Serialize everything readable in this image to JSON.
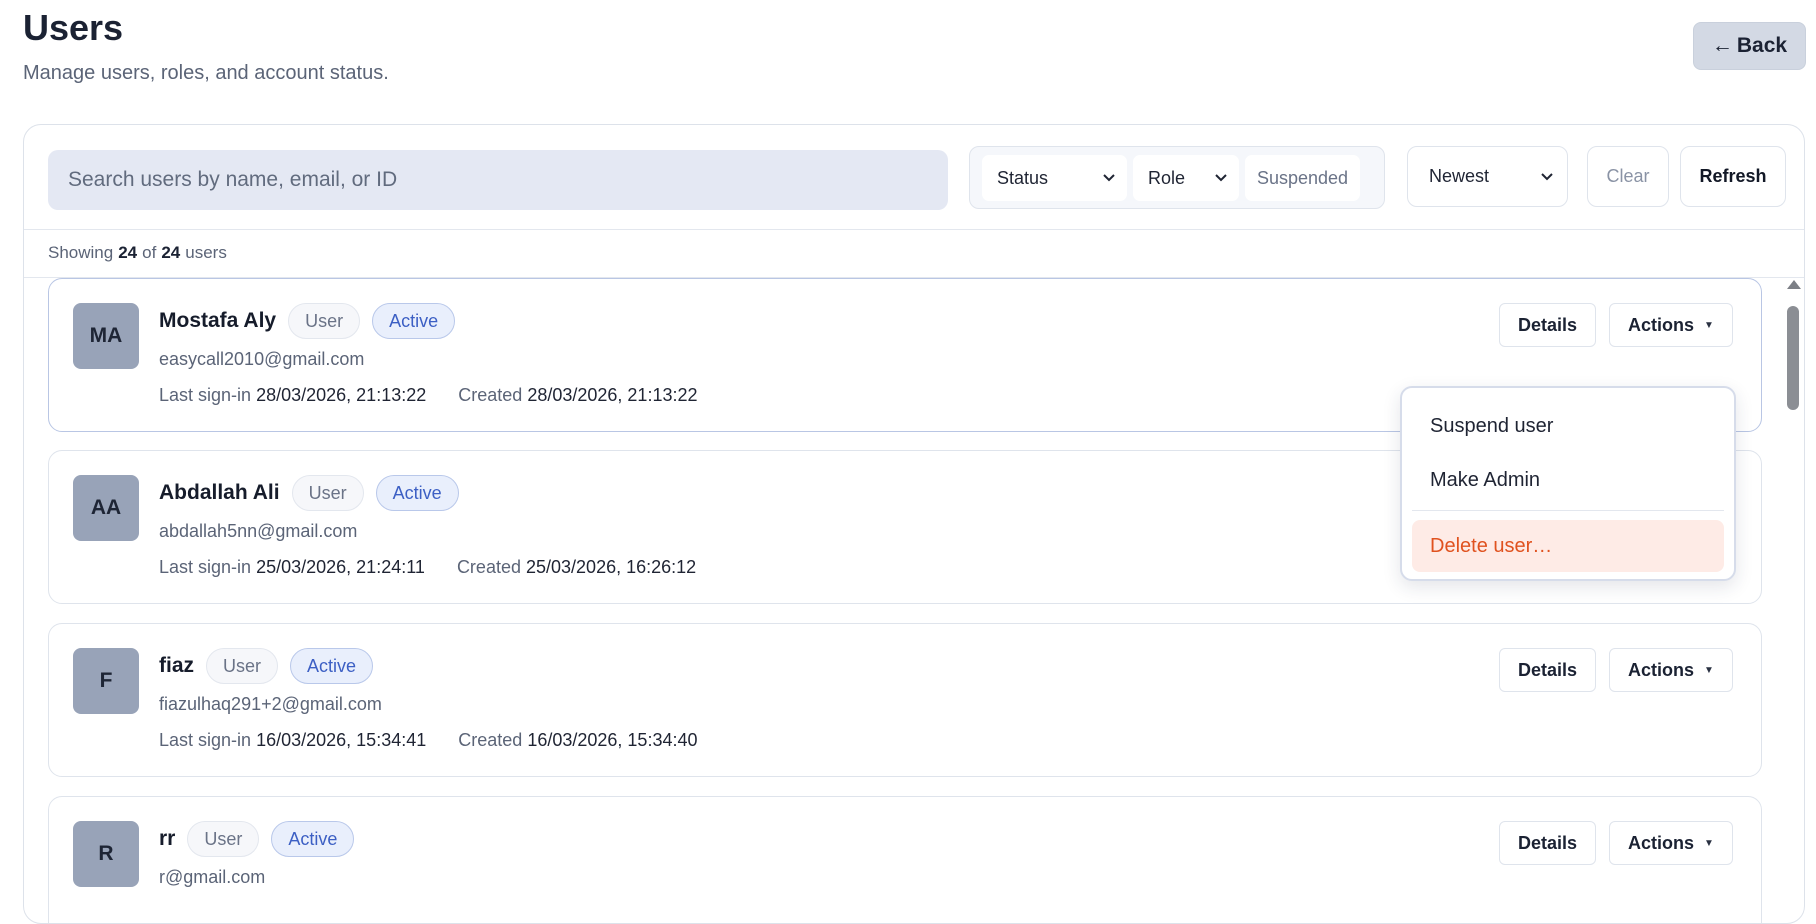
{
  "header": {
    "title": "Users",
    "subtitle": "Manage users, roles, and account status.",
    "back_label": "Back",
    "back_arrow": "←"
  },
  "toolbar": {
    "search_placeholder": "Search users by name, email, or ID",
    "search_value": "",
    "status_label": "Status",
    "role_label": "Role",
    "suspended_label": "Suspended",
    "sort_label": "Newest",
    "clear_label": "Clear",
    "refresh_label": "Refresh"
  },
  "summary": {
    "prefix": "Showing",
    "shown": "24",
    "middle": "of",
    "total": "24",
    "suffix": "users"
  },
  "labels": {
    "last_sign_in": "Last sign-in",
    "created": "Created",
    "details": "Details",
    "actions": "Actions"
  },
  "users": [
    {
      "initials": "MA",
      "name": "Mostafa Aly",
      "role": "User",
      "status": "Active",
      "email": "easycall2010@gmail.com",
      "last_sign_in": "28/03/2026, 21:13:22",
      "created": "28/03/2026, 21:13:22"
    },
    {
      "initials": "AA",
      "name": "Abdallah Ali",
      "role": "User",
      "status": "Active",
      "email": "abdallah5nn@gmail.com",
      "last_sign_in": "25/03/2026, 21:24:11",
      "created": "25/03/2026, 16:26:12"
    },
    {
      "initials": "F",
      "name": "fiaz",
      "role": "User",
      "status": "Active",
      "email": "fiazulhaq291+2@gmail.com",
      "last_sign_in": "16/03/2026, 15:34:41",
      "created": "16/03/2026, 15:34:40"
    },
    {
      "initials": "R",
      "name": "rr",
      "role": "User",
      "status": "Active",
      "email": "r@gmail.com",
      "last_sign_in": "",
      "created": ""
    }
  ],
  "actions_menu": {
    "items": [
      "Suspend user",
      "Make Admin",
      "Delete user…"
    ]
  },
  "colors": {
    "accent_active": "#3c5fc4",
    "danger": "#e0521f",
    "danger_bg": "#feebe6",
    "avatar_bg": "#98a3b8"
  }
}
